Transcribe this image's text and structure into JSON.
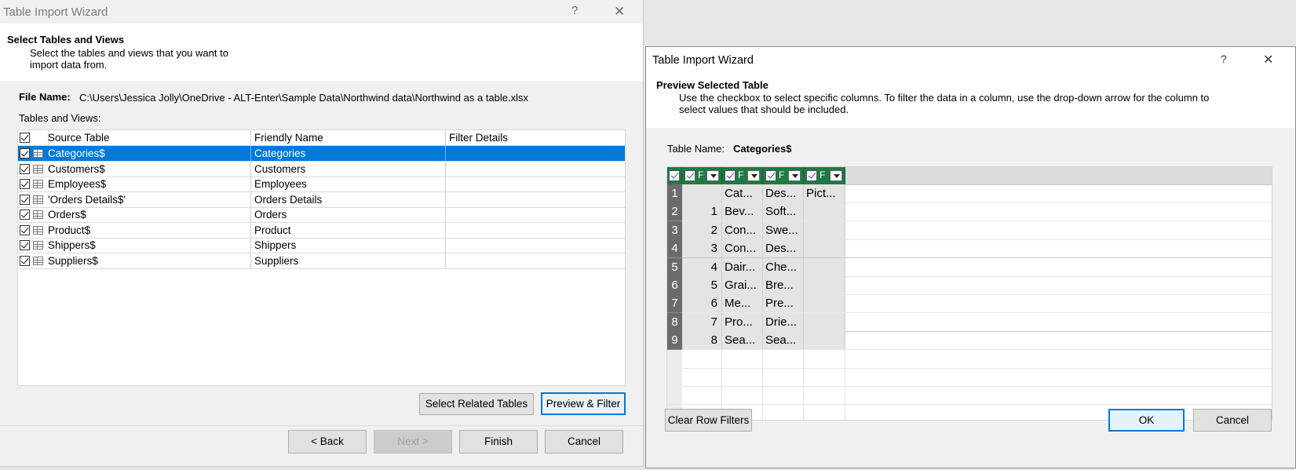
{
  "left_window": {
    "title": "Table Import Wizard",
    "help_glyph": "?",
    "close_glyph": "✕",
    "header": {
      "title": "Select Tables and Views",
      "description_line1": "Select the tables and views that you want to",
      "description_line2": "import data from."
    },
    "file_name_label": "File Name:",
    "file_name_value": "C:\\Users\\Jessica Jolly\\OneDrive - ALT-Enter\\Sample Data\\Northwind data\\Northwind as a table.xlsx",
    "tables_label": "Tables and Views:",
    "columns": [
      "Source Table",
      "Friendly Name",
      "Filter Details"
    ],
    "rows": [
      {
        "source": "Categories$",
        "friendly": "Categories",
        "filter": "",
        "checked": true,
        "selected": true
      },
      {
        "source": "Customers$",
        "friendly": "Customers",
        "filter": "",
        "checked": true,
        "selected": false
      },
      {
        "source": "Employees$",
        "friendly": "Employees",
        "filter": "",
        "checked": true,
        "selected": false
      },
      {
        "source": "'Orders Details$'",
        "friendly": "Orders Details",
        "filter": "",
        "checked": true,
        "selected": false
      },
      {
        "source": "Orders$",
        "friendly": "Orders",
        "filter": "",
        "checked": true,
        "selected": false
      },
      {
        "source": "Product$",
        "friendly": "Product",
        "filter": "",
        "checked": true,
        "selected": false
      },
      {
        "source": "Shippers$",
        "friendly": "Shippers",
        "filter": "",
        "checked": true,
        "selected": false
      },
      {
        "source": "Suppliers$",
        "friendly": "Suppliers",
        "filter": "",
        "checked": true,
        "selected": false
      }
    ],
    "buttons": {
      "select_related": "Select Related Tables",
      "preview_filter": "Preview & Filter",
      "back": "< Back",
      "next": "Next >",
      "finish": "Finish",
      "cancel": "Cancel"
    }
  },
  "right_window": {
    "title": "Table Import Wizard",
    "help_glyph": "?",
    "close_glyph": "✕",
    "header": {
      "title": "Preview Selected Table",
      "description_line1": "Use the checkbox to select specific columns. To filter the data in a column, use the drop-down arrow  for the column to",
      "description_line2": "select values that should be included."
    },
    "table_name_label": "Table Name:",
    "table_name_value": "Categories$",
    "preview_columns": [
      "F",
      "F",
      "F",
      "F"
    ],
    "preview_rows": [
      {
        "num": "1",
        "c1": "",
        "c2": "Cat...",
        "c3": "Des...",
        "c4": "Pict..."
      },
      {
        "num": "2",
        "c1": "1",
        "c2": "Bev...",
        "c3": "Soft...",
        "c4": ""
      },
      {
        "num": "3",
        "c1": "2",
        "c2": "Con...",
        "c3": "Swe...",
        "c4": ""
      },
      {
        "num": "4",
        "c1": "3",
        "c2": "Con...",
        "c3": "Des...",
        "c4": ""
      },
      {
        "num": "5",
        "c1": "4",
        "c2": "Dair...",
        "c3": "Che...",
        "c4": ""
      },
      {
        "num": "6",
        "c1": "5",
        "c2": "Grai...",
        "c3": "Bre...",
        "c4": ""
      },
      {
        "num": "7",
        "c1": "6",
        "c2": "Me...",
        "c3": "Pre...",
        "c4": ""
      },
      {
        "num": "8",
        "c1": "7",
        "c2": "Pro...",
        "c3": "Drie...",
        "c4": ""
      },
      {
        "num": "9",
        "c1": "8",
        "c2": "Sea...",
        "c3": "Sea...",
        "c4": ""
      }
    ],
    "buttons": {
      "clear_filters": "Clear Row Filters",
      "ok": "OK",
      "cancel": "Cancel"
    }
  }
}
